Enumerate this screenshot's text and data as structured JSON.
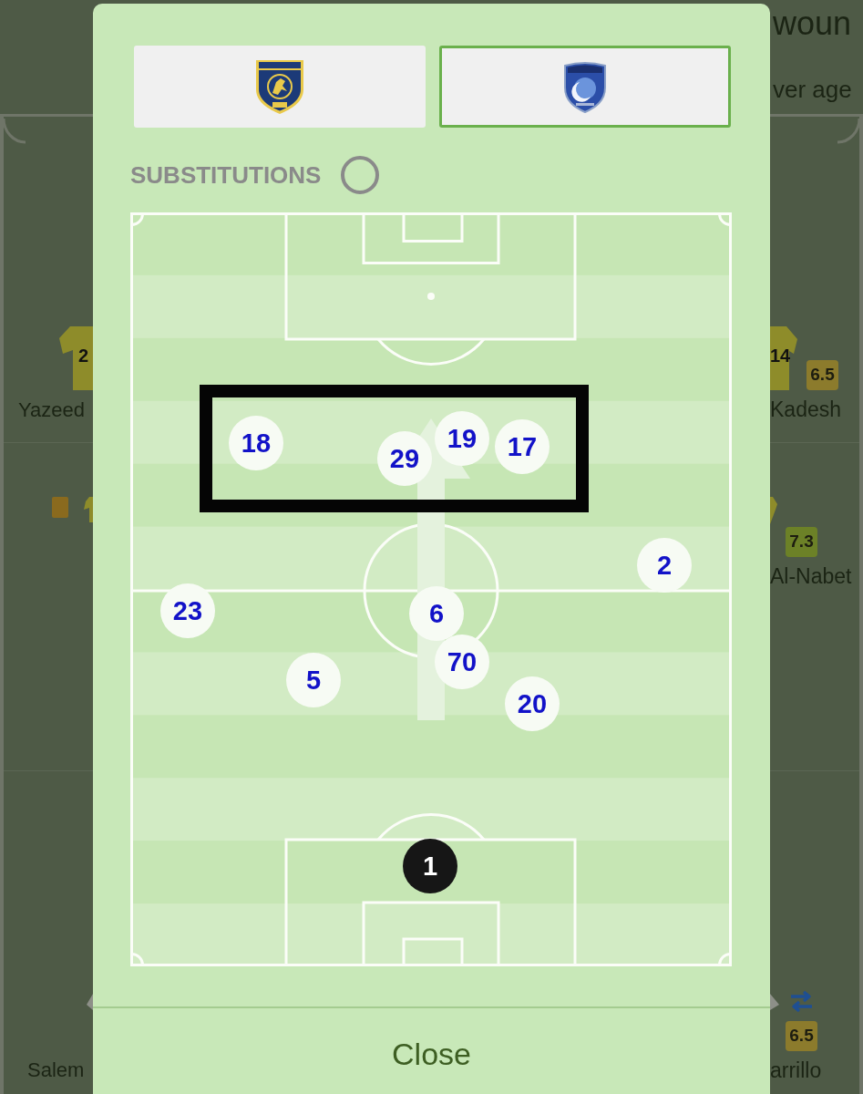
{
  "background": {
    "title": "woun",
    "subtitle": "ver age",
    "left_rows": [
      {
        "shirt_number": "2",
        "name": "Yazeed"
      },
      {
        "yellow_card": true
      },
      {
        "name": "Salem"
      }
    ],
    "right_rows": [
      {
        "shirt_number": "14",
        "rating": "6.5",
        "color": "#8c7b2c",
        "name": "Kadesh"
      },
      {
        "rating": "7.3",
        "color": "#6c8127",
        "name": "Al-Nabet"
      },
      {
        "substituted": true,
        "rating": "6.5",
        "color": "#8c7b2c",
        "name": "arrillo"
      }
    ]
  },
  "dialog": {
    "teams": [
      {
        "kind": "gold",
        "selected": false
      },
      {
        "kind": "blue",
        "selected": true
      }
    ],
    "substitutions": {
      "label": "SUBSTITUTIONS",
      "on": false
    },
    "players": [
      {
        "number": "18",
        "kind": "outfield"
      },
      {
        "number": "29",
        "kind": "outfield"
      },
      {
        "number": "19",
        "kind": "outfield"
      },
      {
        "number": "17",
        "kind": "outfield"
      },
      {
        "number": "23",
        "kind": "outfield"
      },
      {
        "number": "6",
        "kind": "outfield"
      },
      {
        "number": "2",
        "kind": "outfield"
      },
      {
        "number": "5",
        "kind": "outfield"
      },
      {
        "number": "70",
        "kind": "outfield"
      },
      {
        "number": "20",
        "kind": "outfield"
      },
      {
        "number": "1",
        "kind": "goalkeeper"
      }
    ],
    "close_button": "Close"
  }
}
